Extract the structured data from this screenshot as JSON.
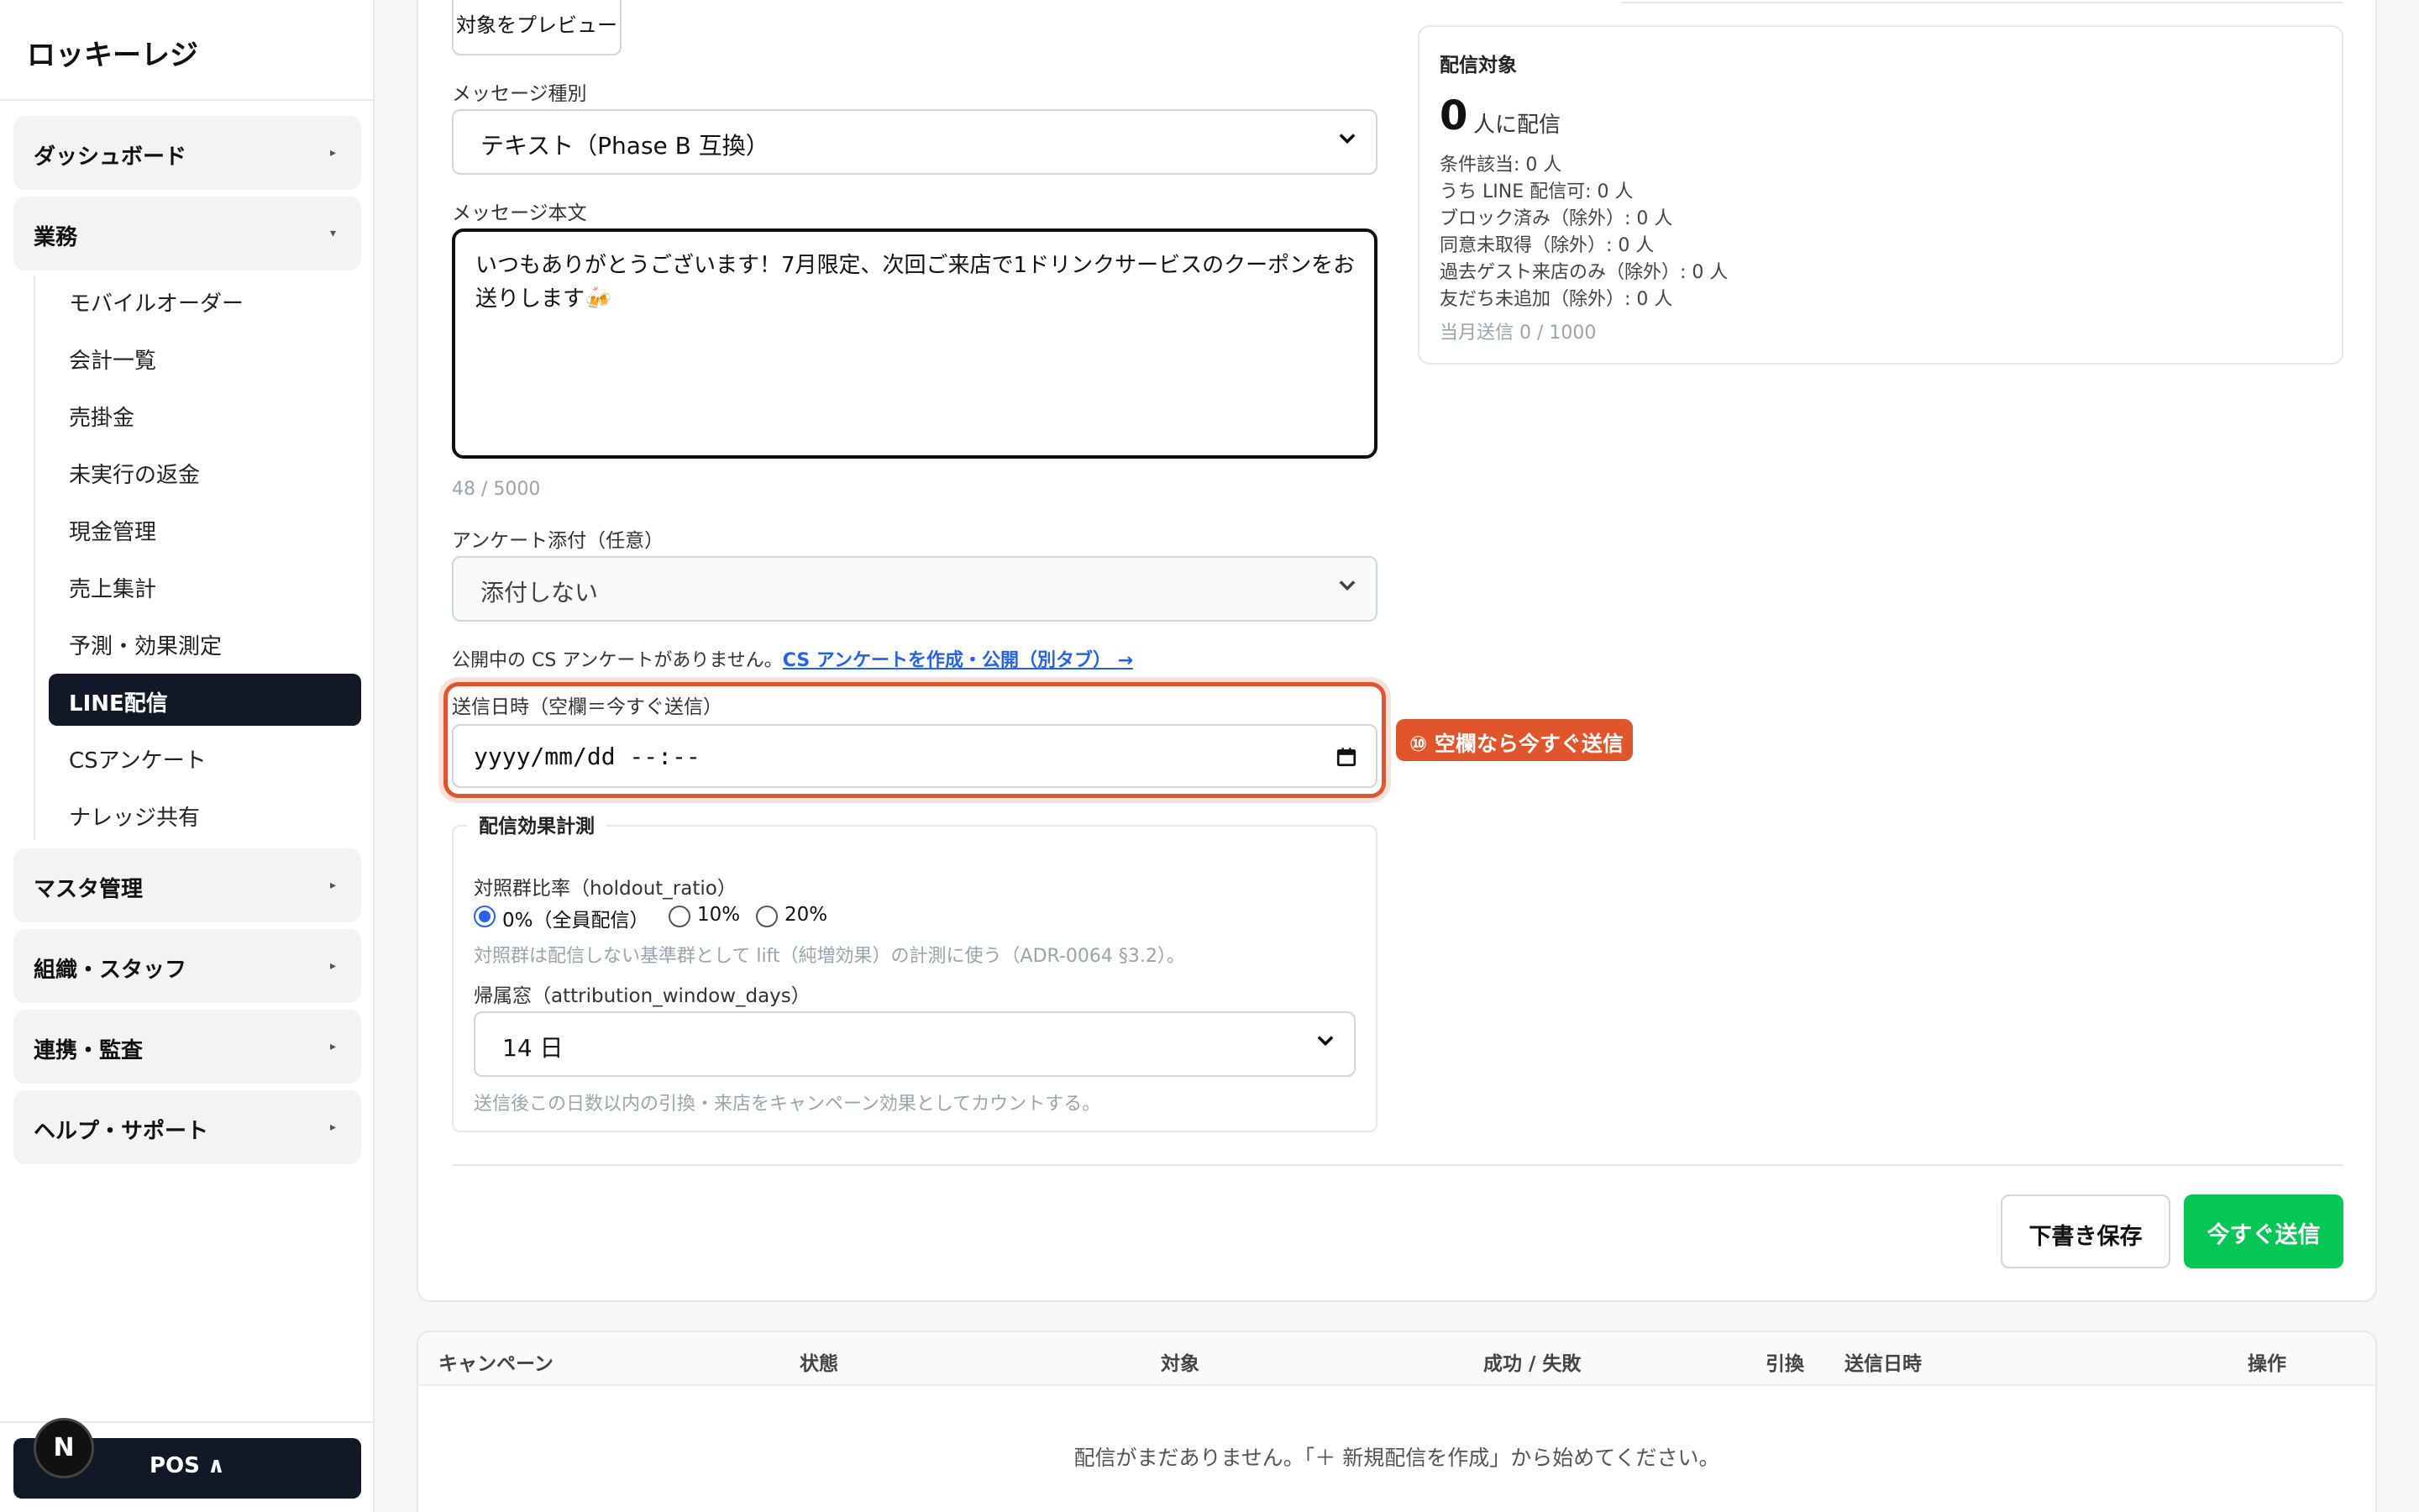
{
  "sidebar": {
    "brand": "ロッキーレジ",
    "groups": {
      "dashboard": "ダッシュボード",
      "operations": "業務",
      "master": "マスタ管理",
      "org": "組織・スタッフ",
      "integration": "連携・監査",
      "help": "ヘルプ・サポート"
    },
    "items": [
      "モバイルオーダー",
      "会計一覧",
      "売掛金",
      "未実行の返金",
      "現金管理",
      "売上集計",
      "予測・効果測定",
      "LINE配信",
      "CSアンケート",
      "ナレッジ共有"
    ],
    "active_item": "LINE配信",
    "pos_button": "POS ∧",
    "avatar_letter": "N"
  },
  "form": {
    "preview_button": "対象をプレビュー",
    "message_type_label": "メッセージ種別",
    "message_type_value": "テキスト（Phase B 互換）",
    "body_label": "メッセージ本文",
    "body_text": "いつもありがとうございます！7月限定、次回ご来店で1ドリンクサービスのクーポンをお送りします🍻",
    "char_count": "48 / 5000",
    "survey_label": "アンケート添付（任意）",
    "survey_value": "添付しない",
    "survey_note": "公開中の CS アンケートがありません。",
    "survey_link": "CS アンケートを作成・公開（別タブ） →",
    "send_time_label": "送信日時（空欄＝今すぐ送信）",
    "send_time_value": "yyyy/mm/dd --:--",
    "hint_tag": "⑩ 空欄なら今すぐ送信",
    "measurement_legend": "配信効果計測",
    "holdout_label": "対照群比率（holdout_ratio）",
    "holdout_options": [
      "0%（全員配信）",
      "10%",
      "20%"
    ],
    "holdout_selected": "0%（全員配信）",
    "holdout_note": "対照群は配信しない基準群として lift（純増効果）の計測に使う（ADR-0064 §3.2）。",
    "window_label": "帰属窓（attribution_window_days）",
    "window_value": "14 日",
    "window_note": "送信後この日数以内の引換・来店をキャンペーン効果としてカウントする。",
    "save_draft_button": "下書き保存",
    "send_now_button": "今すぐ送信"
  },
  "audience": {
    "title": "配信対象",
    "count": "0",
    "count_unit": "人に配信",
    "stats": [
      "条件該当: 0 人",
      "うち LINE 配信可: 0 人",
      "ブロック済み（除外）: 0 人",
      "同意未取得（除外）: 0 人",
      "過去ゲスト来店のみ（除外）: 0 人",
      "友だち未追加（除外）: 0 人"
    ],
    "monthly": "当月送信 0 / 1000"
  },
  "table": {
    "headers": [
      "キャンペーン",
      "状態",
      "対象",
      "成功 / 失敗",
      "引換",
      "送信日時",
      "操作"
    ],
    "empty_message": "配信がまだありません。「＋ 新規配信を作成」から始めてください。"
  },
  "colors": {
    "accent_line": "#06c755",
    "highlight": "#e0552c",
    "link": "#2563eb",
    "sidebar_active": "#111827"
  }
}
